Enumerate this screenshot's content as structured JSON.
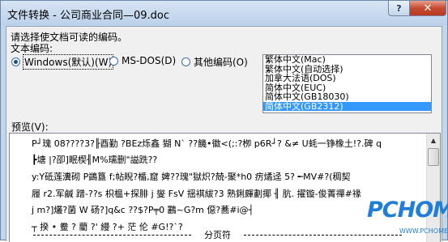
{
  "window": {
    "title": "文件转换 - 公司商业合同—09.doc",
    "help_label": "?",
    "close_label": "✕"
  },
  "form": {
    "instruction": "请选择使文档可读的编码。",
    "encoding_label": "文本编码:",
    "options": [
      {
        "label": "Windows(默认)(W)",
        "checked": true
      },
      {
        "label": "MS-DOS(D)",
        "checked": false
      },
      {
        "label": "其他编码(O)",
        "checked": false
      }
    ]
  },
  "encoding_list": {
    "items": [
      "繁体中文(Mac)",
      "繁体中文(自动选择)",
      "加拿大法语(DOS)",
      "简体中文(EUC)",
      "简体中文(GB18030)",
      "简体中文(GB2312)"
    ],
    "selected_index": 5
  },
  "preview": {
    "label": "预览(V):",
    "lines": [
      "P┘瑰 08????3?╟酉勤  ?BEz烁鑫 猢 N` ??饑•徽<(;:?栁 p6R┘?    &≠ U蚝一铮橡土!?.碑 q",
      "┣塘 |?卲]眠楔╢M%瓀删\"謚跣??",
      "y:Y砥莲瀵砌    P鷁簋 f;帖睨?楯,窟    婢??瑰\"獄炽?兢-聚*h0 疠燏迳 5?   ╾MV#?(稠契",
      "履 r2.军鹹  蹭-??s 枳榅+探腓 j    燮 FsV 揺褀紱?3 熟鋓皹劃揶 ╢ 肮. 擢镟-俊菁禪#禒",
      "j m?]爜?菌 W 砀?]q&c    ??$?P╤0 鸝~G?m 僫?蕎#i@┤",
      "┬   揆      •     鲞    ?     藺     ?'     縵     ?+     茫     伦          #G!?`?"
    ],
    "page_break_label": "分页符"
  },
  "watermark": {
    "brand": "PCHOME",
    "url": "WWW.PCHOME.NET"
  },
  "colors": {
    "selection": "#3399ff",
    "window_frame": "#c2d6ec",
    "close_button": "#c64b32",
    "watermark": "#1f7fd8"
  }
}
